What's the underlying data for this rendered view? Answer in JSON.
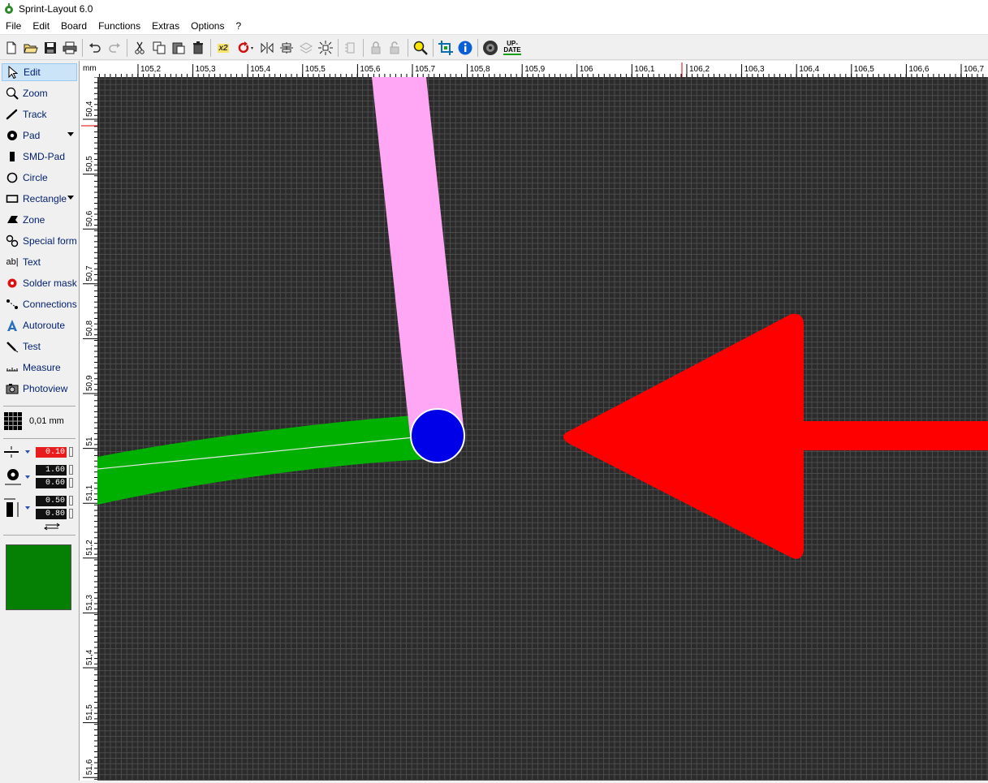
{
  "window": {
    "title": "Sprint-Layout 6.0"
  },
  "menu": [
    "File",
    "Edit",
    "Board",
    "Functions",
    "Extras",
    "Options",
    "?"
  ],
  "toolbar": {
    "zoom_badge": "x2",
    "update_label_top": "UP-",
    "update_label_bottom": "DATE"
  },
  "tools": [
    {
      "label": "Edit",
      "icon": "cursor-arrow-icon",
      "active": true
    },
    {
      "label": "Zoom",
      "icon": "magnifier-icon"
    },
    {
      "label": "Track",
      "icon": "track-icon"
    },
    {
      "label": "Pad",
      "icon": "pad-icon",
      "dropdown": true
    },
    {
      "label": "SMD-Pad",
      "icon": "smd-pad-icon"
    },
    {
      "label": "Circle",
      "icon": "circle-icon"
    },
    {
      "label": "Rectangle",
      "icon": "rectangle-icon",
      "dropdown": true
    },
    {
      "label": "Zone",
      "icon": "zone-icon"
    },
    {
      "label": "Special form",
      "icon": "special-form-icon"
    },
    {
      "label": "Text",
      "icon": "text-icon"
    },
    {
      "label": "Solder mask",
      "icon": "solder-mask-icon"
    },
    {
      "label": "Connections",
      "icon": "connections-icon"
    },
    {
      "label": "Autoroute",
      "icon": "autoroute-icon"
    },
    {
      "label": "Test",
      "icon": "test-icon"
    },
    {
      "label": "Measure",
      "icon": "measure-icon"
    },
    {
      "label": "Photoview",
      "icon": "photoview-icon"
    }
  ],
  "grid": {
    "value": "0,01 mm"
  },
  "params": {
    "track_width": "0.10",
    "pad_outer": "1.60",
    "pad_inner": "0.60",
    "smd_width": "0.50",
    "smd_height": "0.80"
  },
  "colors": {
    "active_layer": "#058005",
    "copper_bottom": "#00b000",
    "copper_top_track": "#ffa6f5",
    "pad_blue": "#0000e8",
    "arrow_red": "#ff0000",
    "canvas_bg": "#2b2b2b"
  },
  "ruler": {
    "unit": "mm",
    "h_labels": [
      "105,2",
      "105,3",
      "105,4",
      "105,5",
      "105,6",
      "105,7",
      "105,8",
      "105,9",
      "106",
      "106,1",
      "106,2",
      "106,3",
      "106,4",
      "106,5",
      "106,6",
      "106,7"
    ],
    "v_labels": [
      "50,4",
      "50,5",
      "50,6",
      "50,7",
      "50,8",
      "50,9",
      "51",
      "51,1",
      "51,2",
      "51,3",
      "51,4",
      "51,5",
      "51,6"
    ]
  }
}
